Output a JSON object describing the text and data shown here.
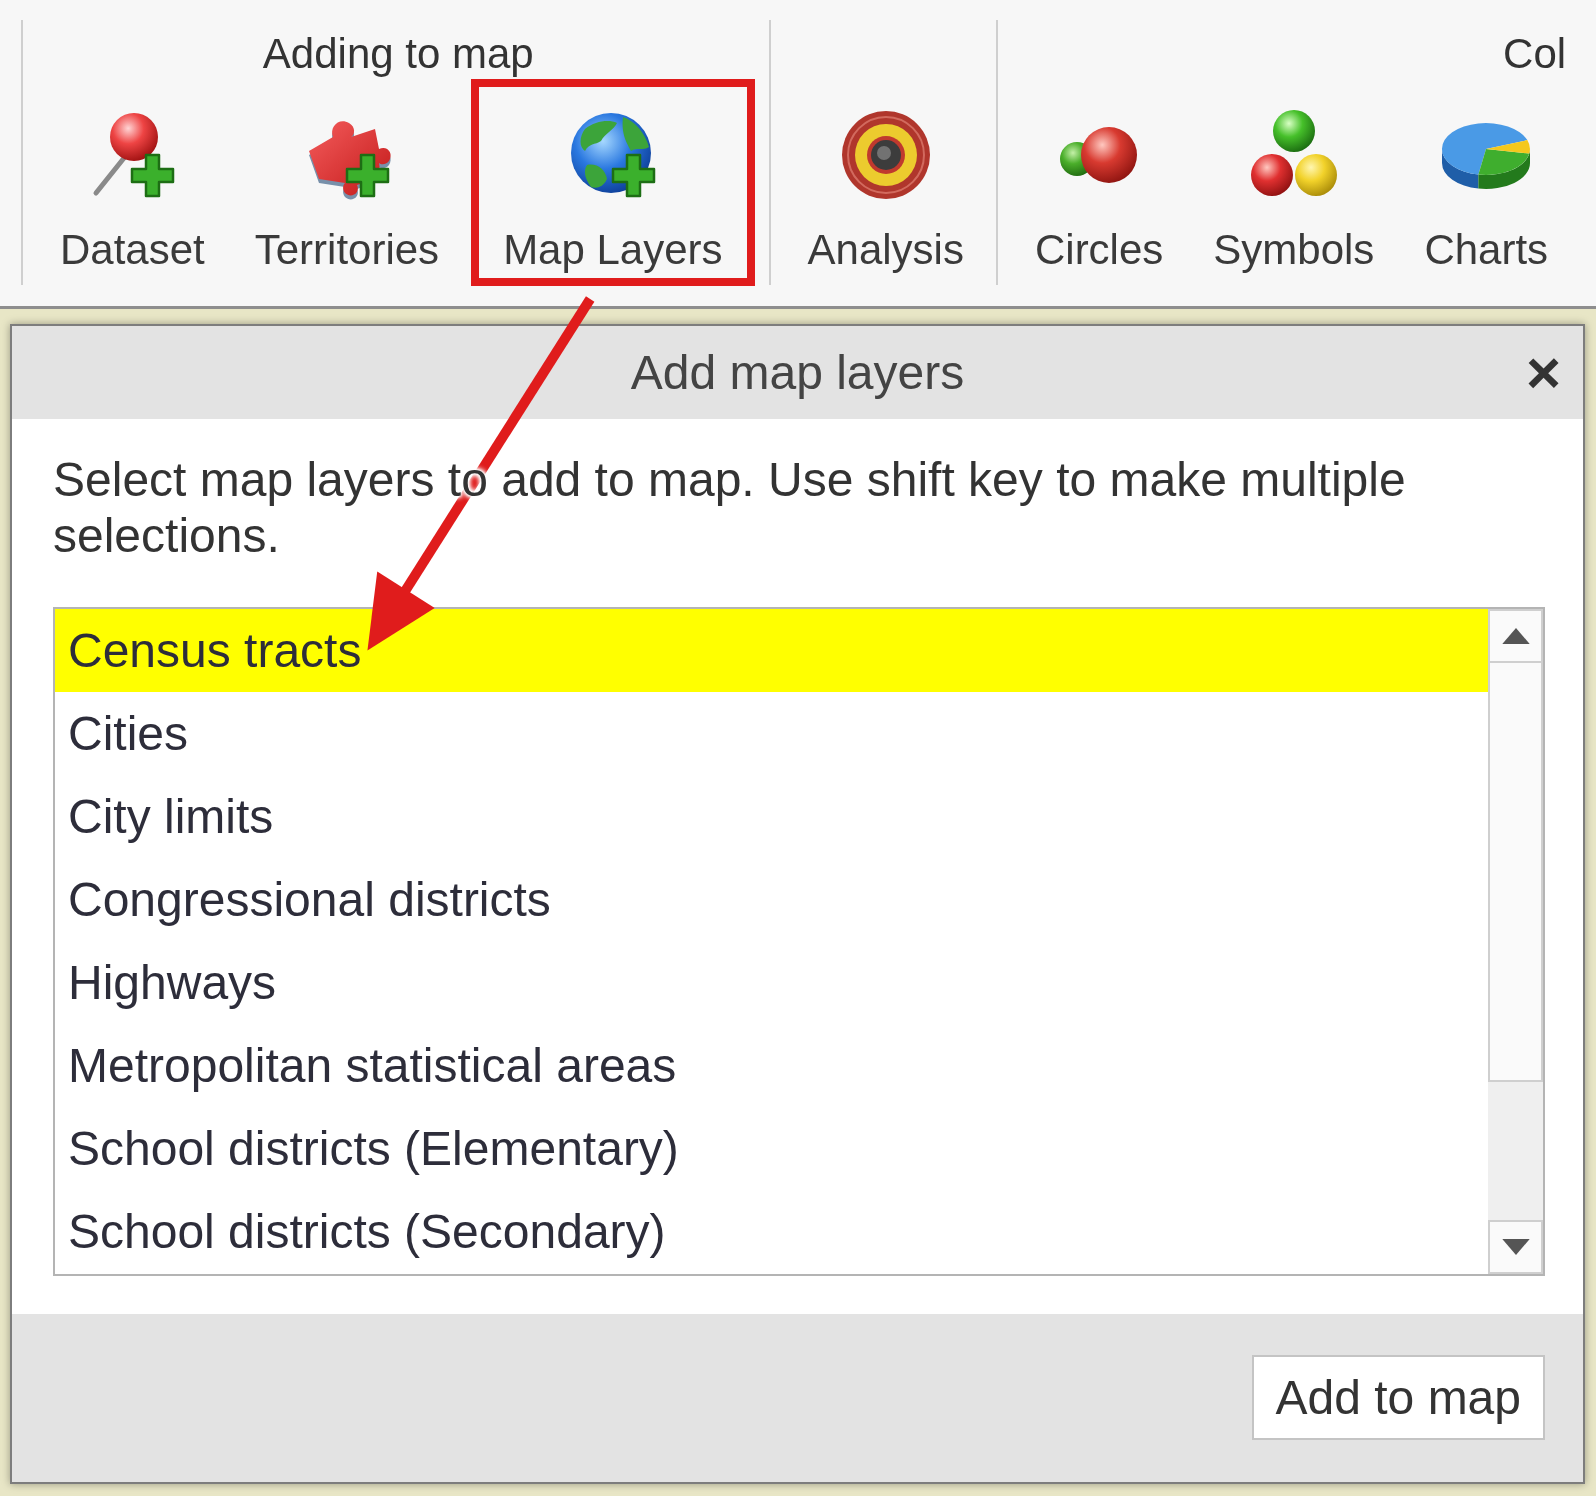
{
  "toolbar": {
    "groups": [
      {
        "label": "Adding to map",
        "buttons": [
          {
            "kind": "dataset",
            "label": "Dataset",
            "highlighted": false
          },
          {
            "kind": "territories",
            "label": "Territories",
            "highlighted": false
          },
          {
            "kind": "layers",
            "label": "Map Layers",
            "highlighted": true
          }
        ]
      },
      {
        "buttons": [
          {
            "kind": "analysis",
            "label": "Analysis",
            "highlighted": false
          }
        ]
      },
      {
        "label": "Col",
        "buttons": [
          {
            "kind": "circles",
            "label": "Circles",
            "highlighted": false
          },
          {
            "kind": "symbols",
            "label": "Symbols",
            "highlighted": false
          },
          {
            "kind": "charts",
            "label": "Charts",
            "highlighted": false
          }
        ]
      }
    ]
  },
  "dialog": {
    "title": "Add map layers",
    "close": "×",
    "description": "Select map layers to add to map. Use shift key to make multiple selections.",
    "layers": [
      {
        "label": "Census tracts",
        "selected": true
      },
      {
        "label": "Cities",
        "selected": false
      },
      {
        "label": "City limits",
        "selected": false
      },
      {
        "label": "Congressional districts",
        "selected": false
      },
      {
        "label": "Highways",
        "selected": false
      },
      {
        "label": "Metropolitan statistical areas",
        "selected": false
      },
      {
        "label": "School districts (Elementary)",
        "selected": false
      },
      {
        "label": "School districts (Secondary)",
        "selected": false
      }
    ],
    "buttons": [
      "Add to map"
    ]
  }
}
